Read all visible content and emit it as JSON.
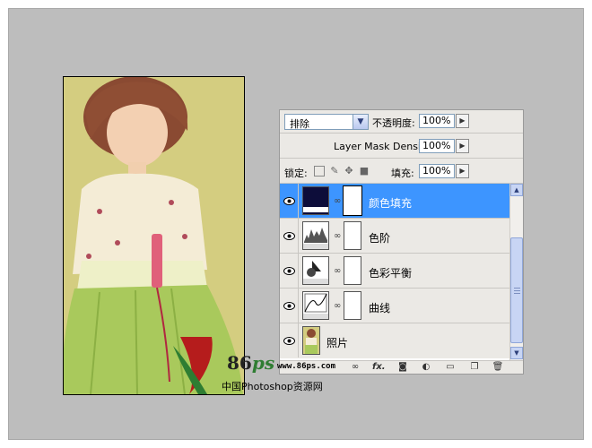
{
  "layers_panel": {
    "blend_mode": "排除",
    "opacity_label": "不透明度:",
    "opacity_value": "100%",
    "mask_density_label": "Layer Mask Density",
    "mask_density_value": "100%",
    "lock_label": "锁定:",
    "fill_label": "填充:",
    "fill_value": "100%",
    "layers": [
      {
        "name": "颜色填充",
        "type": "solid-color",
        "selected": true
      },
      {
        "name": "色阶",
        "type": "levels",
        "selected": false
      },
      {
        "name": "色彩平衡",
        "type": "color-balance",
        "selected": false
      },
      {
        "name": "曲线",
        "type": "curves",
        "selected": false
      },
      {
        "name": "照片",
        "type": "photo",
        "selected": false
      }
    ]
  },
  "watermark": {
    "logo_number": "86",
    "logo_letters": "ps",
    "url": "www.86ps.com",
    "site_name": "中国Photoshop资源网"
  },
  "colors": {
    "selection": "#3d95ff",
    "fill_swatch": "#0d0d3a",
    "canvas": "#bdbdbd"
  }
}
